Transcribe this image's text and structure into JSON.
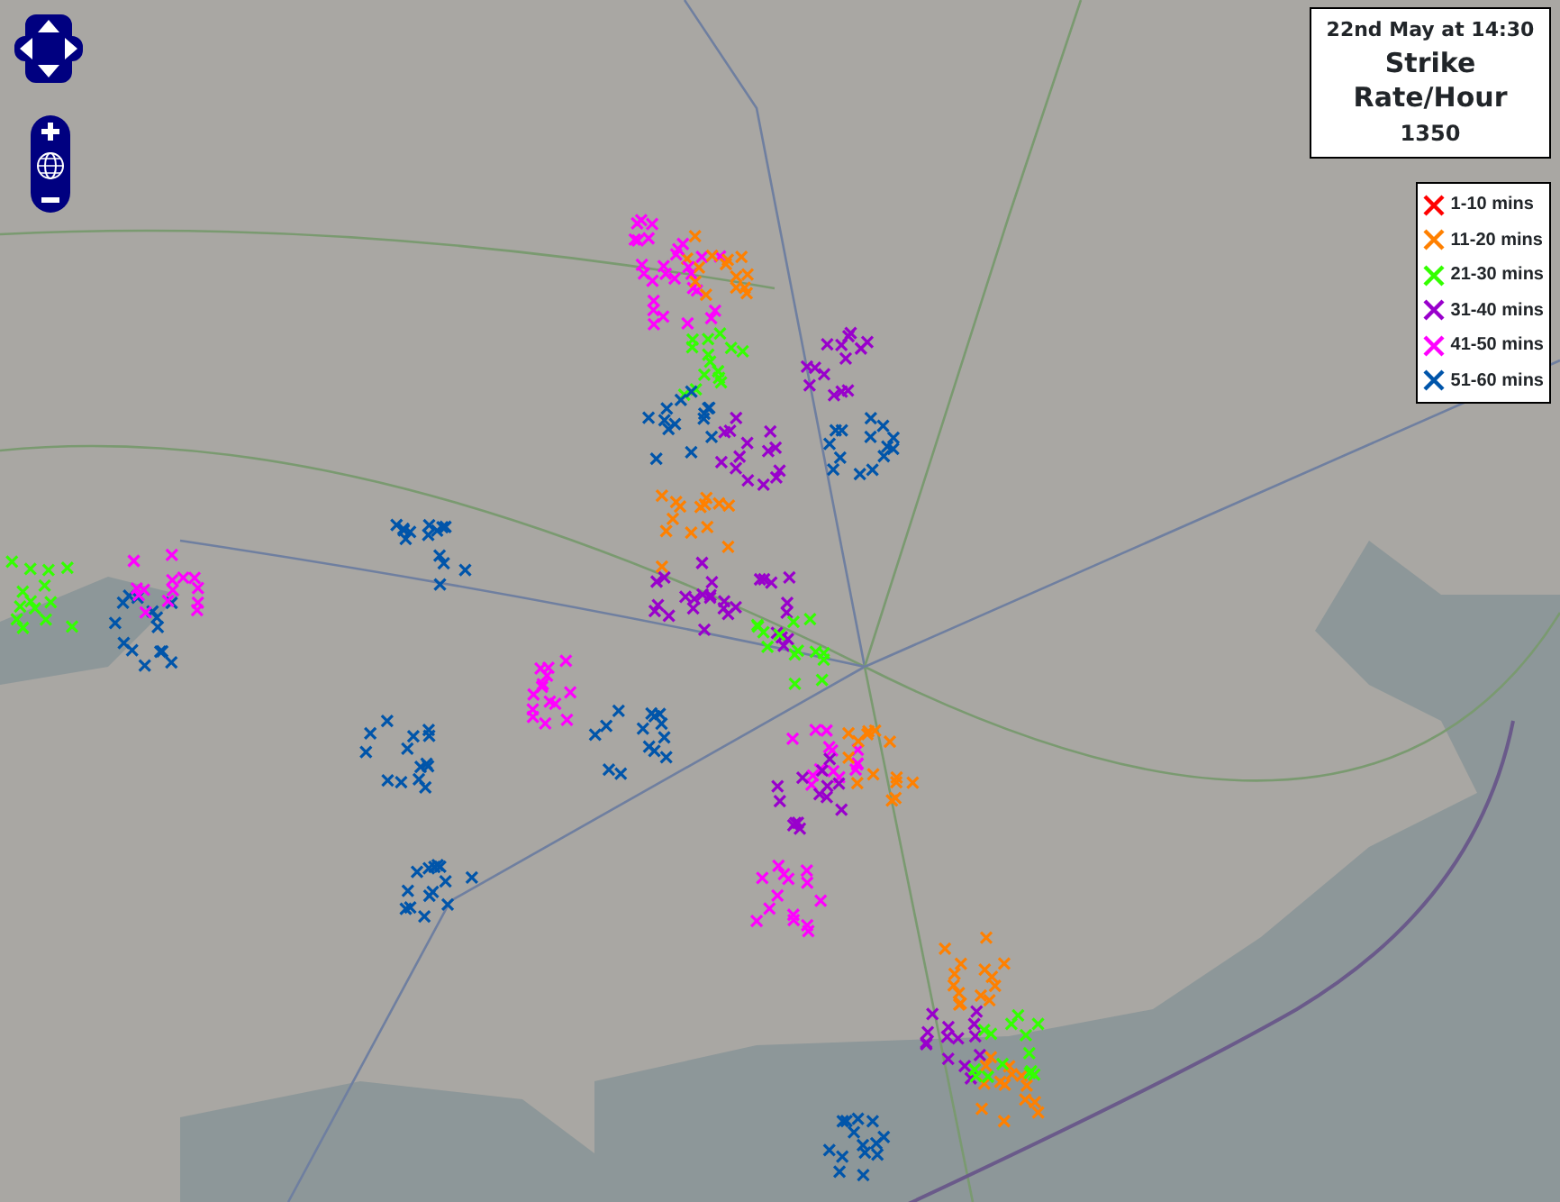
{
  "info_box": {
    "date": "22nd May at 14:30",
    "title": "Strike Rate/Hour",
    "value": "1350"
  },
  "legend": [
    {
      "label": "1-10 mins",
      "color": "#ff0000"
    },
    {
      "label": "11-20 mins",
      "color": "#ff8000"
    },
    {
      "label": "21-30 mins",
      "color": "#33ff00"
    },
    {
      "label": "31-40 mins",
      "color": "#9900cc"
    },
    {
      "label": "41-50 mins",
      "color": "#ff00ff"
    },
    {
      "label": "51-60 mins",
      "color": "#0055aa"
    }
  ]
}
